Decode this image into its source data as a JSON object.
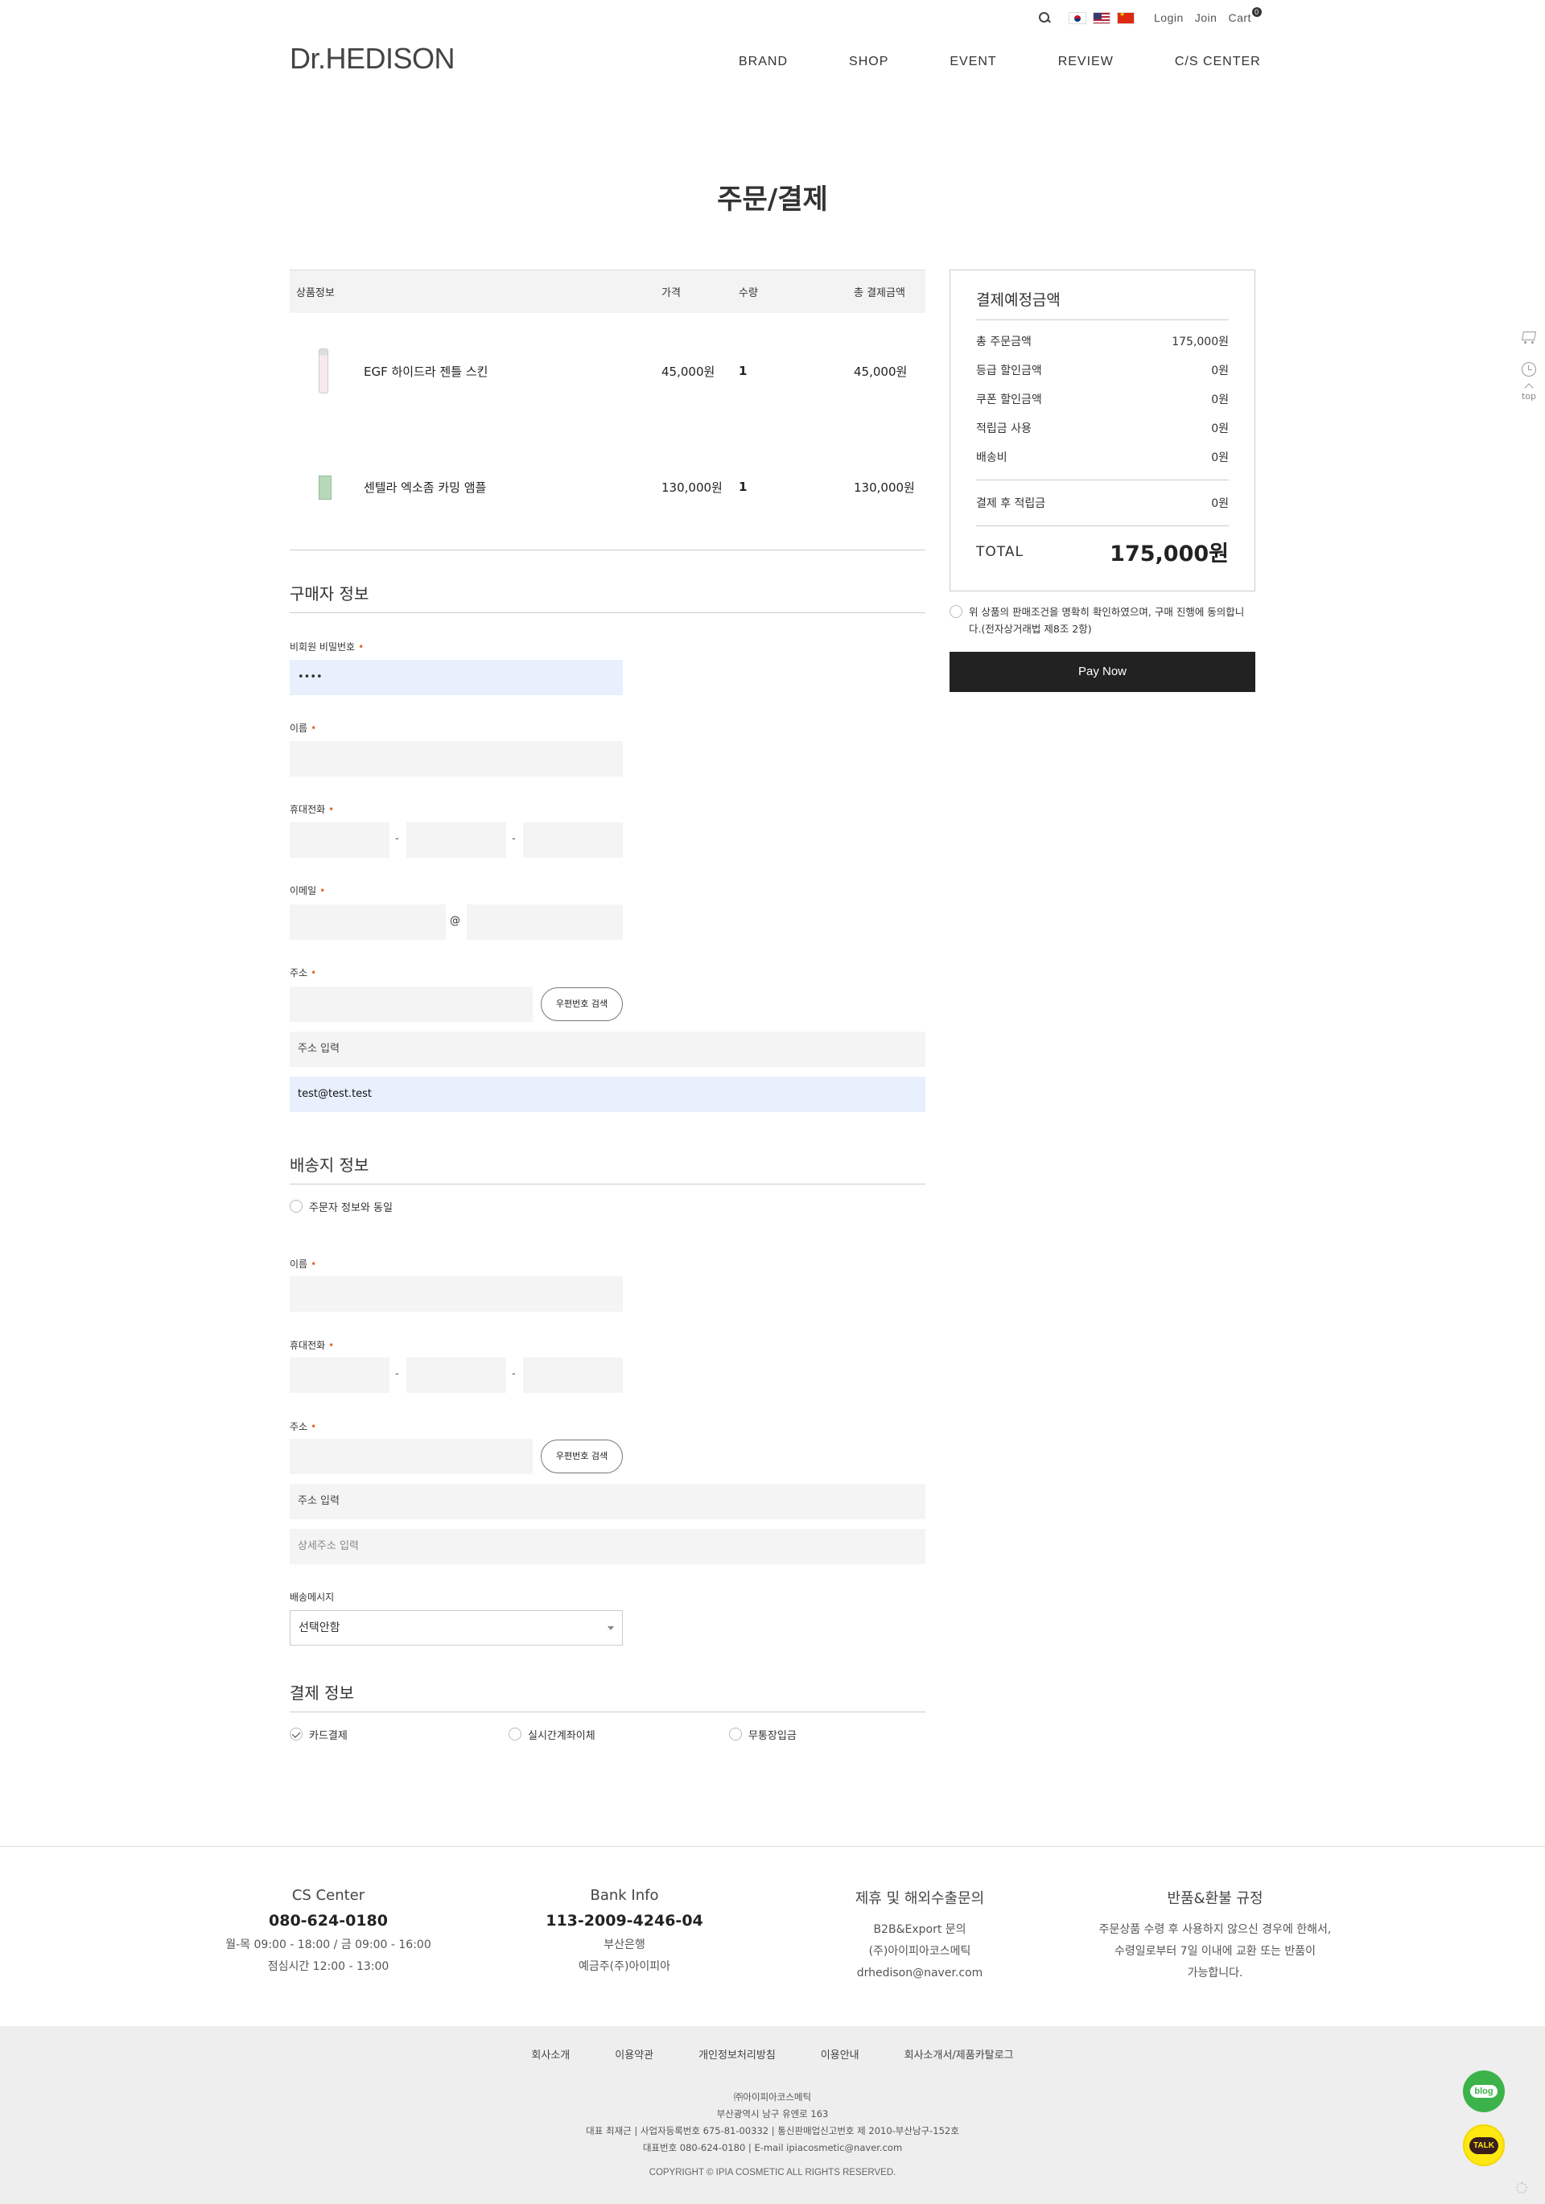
{
  "header": {
    "util_links": {
      "login": "Login",
      "join": "Join",
      "cart": "Cart",
      "cart_count": "0"
    },
    "logo": "Dr.HEDISON",
    "nav": [
      "BRAND",
      "SHOP",
      "EVENT",
      "REVIEW",
      "C/S CENTER"
    ]
  },
  "page_title": "주문/결제",
  "cart": {
    "headers": {
      "product": "상품정보",
      "price": "가격",
      "qty": "수량",
      "total": "총 결제금액"
    },
    "items": [
      {
        "name": "EGF 하이드라 젠틀 스킨",
        "price": "45,000원",
        "qty": "1",
        "total": "45,000원"
      },
      {
        "name": "센텔라 엑소좀 카밍 앰플",
        "price": "130,000원",
        "qty": "1",
        "total": "130,000원"
      }
    ]
  },
  "buyer": {
    "title": "구매자 정보",
    "password_label": "비회원 비밀번호",
    "password_value": "••••",
    "name_label": "이름",
    "phone_label": "휴대전화",
    "email_label": "이메일",
    "at": "@",
    "address_label": "주소",
    "zip_button": "우편번호 검색",
    "address_placeholder": "주소 입력",
    "detail_value": "test@test.test",
    "dash": "-"
  },
  "shipping": {
    "title": "배송지 정보",
    "same_label": "주문자 정보와 동일",
    "name_label": "이름",
    "phone_label": "휴대전화",
    "address_label": "주소",
    "zip_button": "우편번호 검색",
    "address_placeholder": "주소 입력",
    "detail_placeholder": "상세주소 입력",
    "message_label": "배송메시지",
    "message_value": "선택안함",
    "dash": "-"
  },
  "payment": {
    "title": "결제 정보",
    "methods": [
      "카드결제",
      "실시간계좌이체",
      "무통장입금"
    ]
  },
  "summary": {
    "title": "결제예정금액",
    "rows": [
      {
        "label": "총 주문금액",
        "value": "175,000원"
      },
      {
        "label": "등급 할인금액",
        "value": "0원"
      },
      {
        "label": "쿠폰 할인금액",
        "value": "0원"
      },
      {
        "label": "적립금 사용",
        "value": "0원"
      },
      {
        "label": "배송비",
        "value": "0원"
      }
    ],
    "points_label": "결제 후 적립금",
    "points_value": "0원",
    "total_label": "TOTAL",
    "total_value": "175,000원",
    "agree_text": "위 상품의 판매조건을 명확히 확인하였으며, 구매 진행에 동의합니다.(전자상거래법 제8조 2항)",
    "pay_button": "Pay Now"
  },
  "quick": {
    "top": "top"
  },
  "footer": {
    "cs": {
      "title": "CS Center",
      "phone": "080-624-0180",
      "hours": "월-목 09:00 - 18:00 / 금 09:00 - 16:00",
      "lunch": "점심시간 12:00 - 13:00"
    },
    "bank": {
      "title": "Bank Info",
      "account": "113-2009-4246-04",
      "bank": "부산은행",
      "holder": "예금주(주)아이피아"
    },
    "partner": {
      "title": "제휴 및 해외수출문의",
      "l1": "B2B&Export 문의",
      "l2": "(주)아이피아코스메틱",
      "l3": "drhedison@naver.com"
    },
    "refund": {
      "title": "반품&환불 규정",
      "l1": "주문상품 수령 후 사용하지 않으신 경우에 한해서,",
      "l2": "수령일로부터 7일 이내에 교환 또는 반품이",
      "l3": "가능합니다."
    },
    "nav": [
      "회사소개",
      "이용약관",
      "개인정보처리방침",
      "이용안내",
      "회사소개서/제품카탈로그"
    ],
    "info": [
      "㈜아이피아코스메틱",
      "부산광역시 남구 유엔로 163",
      "대표 최재근 | 사업자등록번호 675-81-00332 | 통신판매업신고번호 제 2010-부산남구-152호",
      "대표번호 080-624-0180 | E-mail ipiacosmetic@naver.com"
    ],
    "copyright": "COPYRIGHT © IPIA COSMETIC ALL RIGHTS RESERVED.",
    "blog": "blog",
    "talk": "TALK"
  }
}
